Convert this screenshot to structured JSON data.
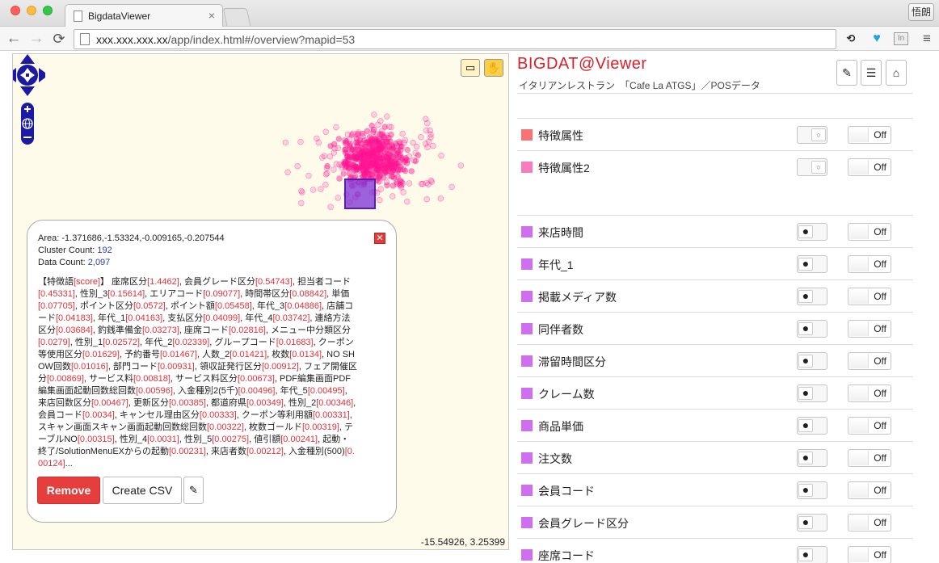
{
  "browser": {
    "tab_title": "BigdataViewer",
    "tab_close": "×",
    "url_host": "xxx.xxx.xxx.xx",
    "url_path": "/app/index.html#/overview?mapid=53",
    "user_name": "悟朗"
  },
  "map": {
    "coordinates": "-15.54926, 3.25399",
    "point_color": "#ff1493",
    "selection_color": "#7b2fd6"
  },
  "popup": {
    "area_label": "Area:",
    "area_value": "-1.371686,-1.53324,-0.009165,-0.207544",
    "cluster_label": "Cluster Count:",
    "cluster_value": "192",
    "data_label": "Data Count:",
    "data_value": "2,097",
    "feature_prefix": "【特徴語",
    "feature_score": "[score]",
    "feature_suffix": "】",
    "features": [
      [
        "座席区分",
        "[1.4462]"
      ],
      [
        "会員グレード区分",
        "[0.54743]"
      ],
      [
        "担当者コード",
        "[0.45331]"
      ],
      [
        "性別_3",
        "[0.15614]"
      ],
      [
        "エリアコード",
        "[0.09077]"
      ],
      [
        "時間帯区分",
        "[0.08842]"
      ],
      [
        "単価",
        "[0.07705]"
      ],
      [
        "ポイント区分",
        "[0.0572]"
      ],
      [
        "ポイント額",
        "[0.05458]"
      ],
      [
        "年代_3",
        "[0.04886]"
      ],
      [
        "店舗コード",
        "[0.04183]"
      ],
      [
        "年代_1",
        "[0.04163]"
      ],
      [
        "支払区分",
        "[0.04099]"
      ],
      [
        "年代_4",
        "[0.03742]"
      ],
      [
        "連絡方法区分",
        "[0.03684]"
      ],
      [
        "釣銭準備金",
        "[0.03273]"
      ],
      [
        "座席コード",
        "[0.02816]"
      ],
      [
        "メニュー中分類区分",
        "[0.0279]"
      ],
      [
        "性別_1",
        "[0.02572]"
      ],
      [
        "年代_2",
        "[0.02339]"
      ],
      [
        "グループコード",
        "[0.01683]"
      ],
      [
        "クーポン等使用区分",
        "[0.01629]"
      ],
      [
        "予約番号",
        "[0.01467]"
      ],
      [
        "人数_2",
        "[0.01421]"
      ],
      [
        "枚数",
        "[0.0134]"
      ],
      [
        "NO SHOW回数",
        "[0.01016]"
      ],
      [
        "部門コード",
        "[0.00931]"
      ],
      [
        "領収証発行区分",
        "[0.00912]"
      ],
      [
        "フェア開催区分",
        "[0.00869]"
      ],
      [
        "サービス料",
        "[0.00818]"
      ],
      [
        "サービス料区分",
        "[0.00673]"
      ],
      [
        "PDF編集画面PDF編集画面起動回数総回数",
        "[0.00596]"
      ],
      [
        "入金種別2(5千)",
        "[0.00496]"
      ],
      [
        "年代_5",
        "[0.00495]"
      ],
      [
        "来店回数区分",
        "[0.00467]"
      ],
      [
        "更新区分",
        "[0.00385]"
      ],
      [
        "都道府県",
        "[0.00349]"
      ],
      [
        "性別_2",
        "[0.00346]"
      ],
      [
        "会員コード",
        "[0.0034]"
      ],
      [
        "キャンセル理由区分",
        "[0.00333]"
      ],
      [
        "クーポン等利用額",
        "[0.00331]"
      ],
      [
        "スキャン画面スキャン画面起動回数総回数",
        "[0.00322]"
      ],
      [
        "枚数ゴールド",
        "[0.00319]"
      ],
      [
        "テーブルNO",
        "[0.00315]"
      ],
      [
        "性別_4",
        "[0.0031]"
      ],
      [
        "性別_5",
        "[0.00275]"
      ],
      [
        "値引額",
        "[0.00241]"
      ],
      [
        "起動・終了/SolutionMenuEXからの起動",
        "[0.00231]"
      ],
      [
        "来店者数",
        "[0.00212]"
      ],
      [
        "入金種別(500)",
        "[0.00124]"
      ]
    ],
    "ellipsis": "...",
    "remove_label": "Remove",
    "csv_label": "Create CSV",
    "close_icon": "close-icon",
    "edit_icon": "edit-icon"
  },
  "panel": {
    "brand": "BIGDAT@Viewer",
    "subtitle": "イタリアンレストラン　「Cafe La ATGS」／POSデータ",
    "toggle_off_label": "Off",
    "radio_off_glyph": "○",
    "radio_on_glyph": "●",
    "group1": [
      {
        "label": "特徴属性",
        "color": "#f77376",
        "radio": "off"
      },
      {
        "label": "特徴属性2",
        "color": "#f77bbf",
        "radio": "off"
      }
    ],
    "group2": [
      {
        "label": "来店時間",
        "color": "#d06ef0",
        "radio": "on"
      },
      {
        "label": "年代_1",
        "color": "#d06ef0",
        "radio": "on"
      },
      {
        "label": "掲載メディア数",
        "color": "#d06ef0",
        "radio": "on"
      },
      {
        "label": "同伴者数",
        "color": "#d06ef0",
        "radio": "on"
      },
      {
        "label": "滞留時間区分",
        "color": "#d06ef0",
        "radio": "on"
      },
      {
        "label": "クレーム数",
        "color": "#d06ef0",
        "radio": "on"
      },
      {
        "label": "商品単価",
        "color": "#d06ef0",
        "radio": "on"
      },
      {
        "label": "注文数",
        "color": "#d06ef0",
        "radio": "on"
      },
      {
        "label": "会員コード",
        "color": "#d06ef0",
        "radio": "on"
      },
      {
        "label": "会員グレード区分",
        "color": "#d06ef0",
        "radio": "on"
      },
      {
        "label": "座席コード",
        "color": "#d06ef0",
        "radio": "on"
      }
    ]
  }
}
